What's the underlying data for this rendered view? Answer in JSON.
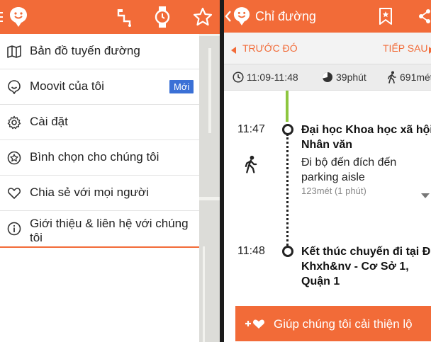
{
  "left": {
    "menu": [
      {
        "label": "Bản đồ tuyến đường",
        "icon": "map-icon"
      },
      {
        "label": "Moovit của tôi",
        "icon": "smile-icon",
        "badge": "Mới"
      },
      {
        "label": "Cài đặt",
        "icon": "gear-icon"
      },
      {
        "label": "Bình chọn cho chúng tôi",
        "icon": "star-circle-icon"
      },
      {
        "label": "Chia sẻ với mọi người",
        "icon": "heart-icon"
      },
      {
        "label": "Giới thiệu & liên hệ với chúng tôi",
        "icon": "info-icon"
      }
    ]
  },
  "right": {
    "header": {
      "title": "Chỉ đường"
    },
    "nav": {
      "prev": "TRƯỚC ĐÓ",
      "next": "TIẾP SAU"
    },
    "summary": {
      "time_range": "11:09-11:48",
      "duration": "39phút",
      "distance": "691mét"
    },
    "steps": {
      "start": {
        "time": "11:47",
        "name_line1": "Đại học Khoa học xã hội",
        "name_line2": "Nhân văn"
      },
      "walk": {
        "line1": "Đi bộ đến đích đến",
        "line2": "parking aisle",
        "distance": "123mét (1 phút)"
      },
      "end": {
        "time": "11:48",
        "name_line1": "Kết thúc chuyến đi tại Đ",
        "name_line2": "Khxh&nv - Cơ Sở 1,",
        "name_line3": "Quận 1"
      }
    },
    "cta": {
      "label": "Giúp chúng tôi cải thiện lộ"
    }
  },
  "colors": {
    "accent": "#f26b38",
    "badge": "#3a70d6",
    "route": "#8dc63f"
  }
}
